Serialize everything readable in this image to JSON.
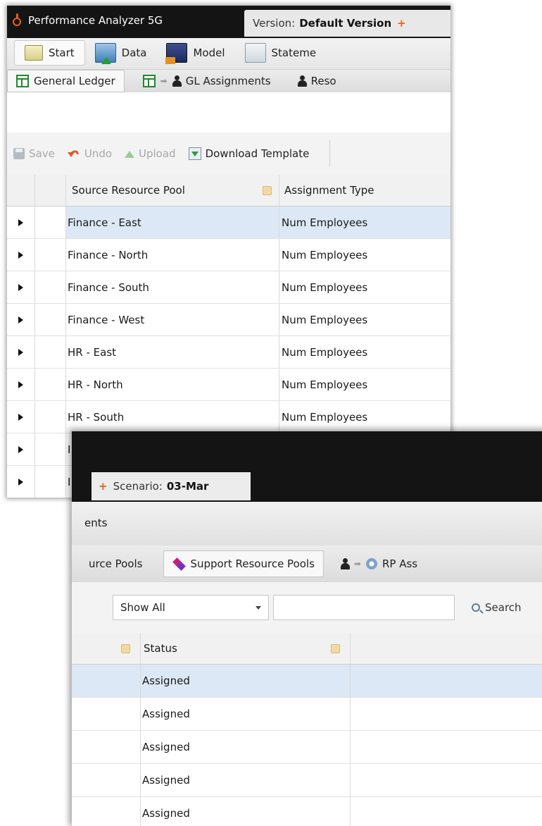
{
  "app": {
    "title": "Performance Analyzer 5G"
  },
  "version_tab": {
    "label": "Version:",
    "value": "Default Version"
  },
  "scenario_tab": {
    "label": "Scenario:",
    "value": "03-Mar"
  },
  "ribbon": {
    "items": [
      {
        "label": "Start",
        "icon": "start-icon"
      },
      {
        "label": "Data",
        "icon": "data-icon"
      },
      {
        "label": "Model",
        "icon": "model-icon"
      },
      {
        "label": "Stateme",
        "icon": "statements-icon"
      }
    ],
    "window2_label": "ents"
  },
  "subnav": {
    "general_ledger": "General Ledger",
    "gl_assignments": "GL Assignments",
    "reso": "Reso",
    "resource_pools_partial": "urce Pools",
    "support_resource_pools": "Support Resource Pools",
    "rp_assignments_partial": "RP Ass"
  },
  "toolbar": {
    "save": "Save",
    "undo": "Undo",
    "upload": "Upload",
    "download_template": "Download Template"
  },
  "filter": {
    "show_value": "Show All",
    "search_value": "",
    "search_label": "Search"
  },
  "grid1": {
    "headers": {
      "source": "Source Resource Pool",
      "type": "Assignment Type"
    },
    "rows": [
      {
        "source": "Finance - East",
        "type": "Num Employees"
      },
      {
        "source": "Finance - North",
        "type": "Num Employees"
      },
      {
        "source": "Finance - South",
        "type": "Num Employees"
      },
      {
        "source": "Finance - West",
        "type": "Num Employees"
      },
      {
        "source": "HR - East",
        "type": "Num Employees"
      },
      {
        "source": "HR - North",
        "type": "Num Employees"
      },
      {
        "source": "HR - South",
        "type": "Num Employees"
      },
      {
        "source": "I",
        "type": ""
      },
      {
        "source": "I",
        "type": ""
      }
    ]
  },
  "grid2": {
    "headers": {
      "status": "Status"
    },
    "rows": [
      {
        "status": "Assigned"
      },
      {
        "status": "Assigned"
      },
      {
        "status": "Assigned"
      },
      {
        "status": "Assigned"
      },
      {
        "status": "Assigned"
      }
    ]
  },
  "colors": {
    "accent": "#e8601a",
    "selected_row": "#dce8f5",
    "titlebar": "#141414"
  }
}
